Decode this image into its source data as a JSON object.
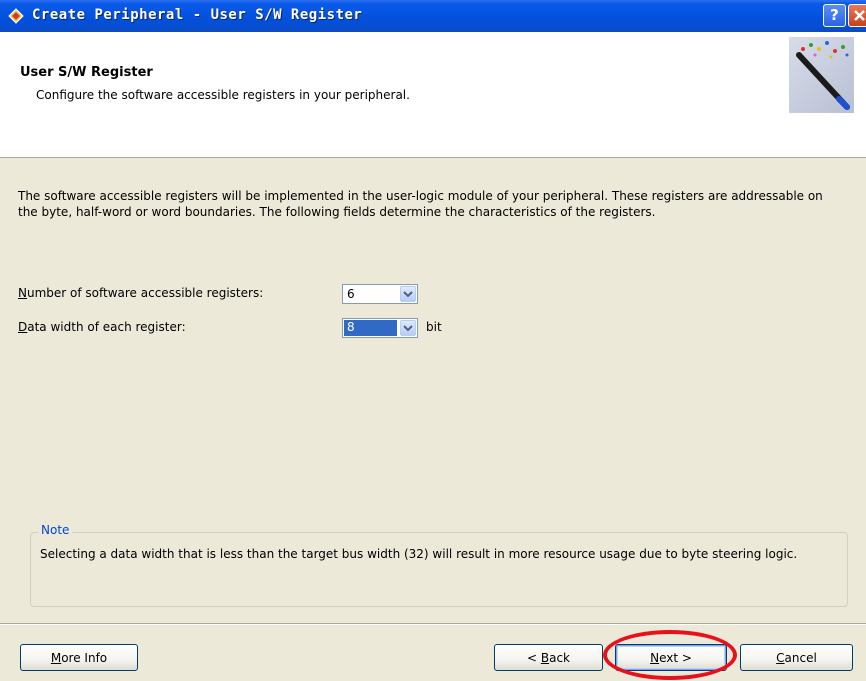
{
  "window": {
    "title": "Create Peripheral - User S/W Register",
    "help_label": "?",
    "icons": [
      "app-diamond-icon",
      "help-icon",
      "close-icon"
    ]
  },
  "header": {
    "title": "User S/W Register",
    "subtitle": "Configure the software accessible registers in your peripheral."
  },
  "body": {
    "description": "The software accessible registers will be implemented in the user-logic module of your peripheral. These registers are addressable on the byte, half-word or word boundaries. The following fields determine the characteristics of the registers."
  },
  "fields": {
    "num_registers": {
      "label_mnemonic": "N",
      "label_rest": "umber of software accessible registers:",
      "value": "6"
    },
    "data_width": {
      "label_mnemonic": "D",
      "label_rest": "ata width of each register:",
      "value": "8",
      "unit": "bit"
    }
  },
  "note": {
    "legend": "Note",
    "text": "Selecting a data width that is less than the target bus width (32) will result in more resource usage due to byte steering logic."
  },
  "buttons": {
    "more_info": {
      "mnemonic": "M",
      "rest": "ore Info"
    },
    "back": {
      "prefix": "< ",
      "mnemonic": "B",
      "rest": "ack"
    },
    "next": {
      "mnemonic": "N",
      "rest": "ext >"
    },
    "cancel": {
      "mnemonic": "C",
      "rest": "ancel"
    }
  },
  "colors": {
    "titlebar": "#0553e1",
    "dialog_bg": "#ece9d8",
    "selection": "#316ac5",
    "note_legend": "#0046d5",
    "annotation_ring": "#e8101a"
  }
}
